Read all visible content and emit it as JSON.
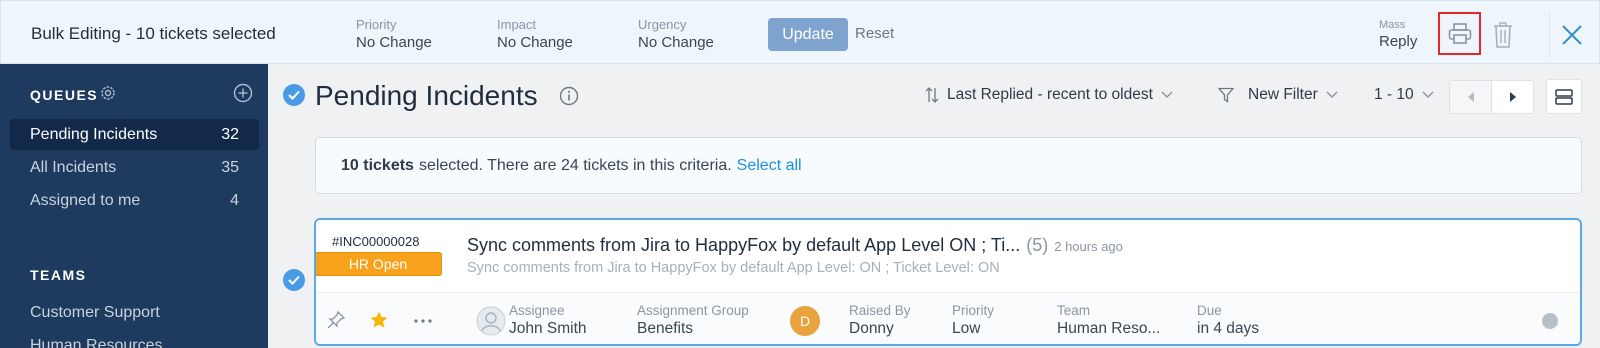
{
  "bulk": {
    "title": "Bulk Editing - 10 tickets selected",
    "fields": [
      {
        "label": "Priority",
        "value": "No Change"
      },
      {
        "label": "Impact",
        "value": "No Change"
      },
      {
        "label": "Urgency",
        "value": "No Change"
      }
    ],
    "update_label": "Update",
    "reset_label": "Reset",
    "mass_label": "Mass",
    "mass_value": "Reply"
  },
  "sidebar": {
    "queues_title": "QUEUES",
    "items": [
      {
        "label": "Pending Incidents",
        "count": "32"
      },
      {
        "label": "All Incidents",
        "count": "35"
      },
      {
        "label": "Assigned to me",
        "count": "4"
      }
    ],
    "teams_title": "TEAMS",
    "teams": [
      {
        "label": "Customer Support"
      },
      {
        "label": "Human Resources"
      }
    ]
  },
  "main": {
    "title": "Pending Incidents",
    "sort_label": "Last Replied - recent to oldest",
    "filter_label": "New Filter",
    "range_label": "1 - 10"
  },
  "banner": {
    "bold": "10 tickets",
    "text": "selected. There are 24 tickets in this criteria.",
    "link": "Select all"
  },
  "ticket": {
    "id": "#INC00000028",
    "status": "HR Open",
    "subject": "Sync comments from Jira to HappyFox by default App Level ON ; Ti...",
    "count": "(5)",
    "ago": "2 hours ago",
    "preview": "Sync comments from Jira to HappyFox by default App Level: ON ; Ticket Level: ON",
    "meta": {
      "assignee_label": "Assignee",
      "assignee": "John Smith",
      "group_label": "Assignment Group",
      "group": "Benefits",
      "raised_label": "Raised By",
      "raised": "Donny",
      "raised_initial": "D",
      "priority_label": "Priority",
      "priority": "Low",
      "team_label": "Team",
      "team": "Human Reso...",
      "due_label": "Due",
      "due": "in 4 days"
    }
  },
  "colors": {
    "sidebar_bg": "#1e3a5f",
    "accent": "#4a9be6",
    "status_orange": "#f7a21a",
    "print_highlight": "#e0282e"
  }
}
